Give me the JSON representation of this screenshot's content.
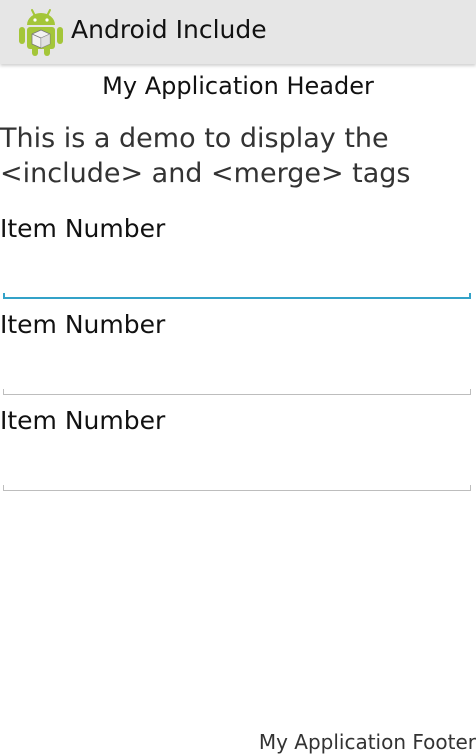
{
  "app_bar": {
    "title": "Android Include",
    "icon": "android-robot-icon",
    "background": "#e6e6e6"
  },
  "header": {
    "text": "My Application Header"
  },
  "description": {
    "text": "This is a demo to display the\n<include> and <merge> tags"
  },
  "items": [
    {
      "label": "Item Number",
      "value": "",
      "focused": true
    },
    {
      "label": "Item Number",
      "value": "",
      "focused": false
    },
    {
      "label": "Item Number",
      "value": "",
      "focused": false
    }
  ],
  "footer": {
    "text": "My Application Footer"
  },
  "colors": {
    "focus_accent": "#33a2c8",
    "android_green": "#a4c639"
  }
}
